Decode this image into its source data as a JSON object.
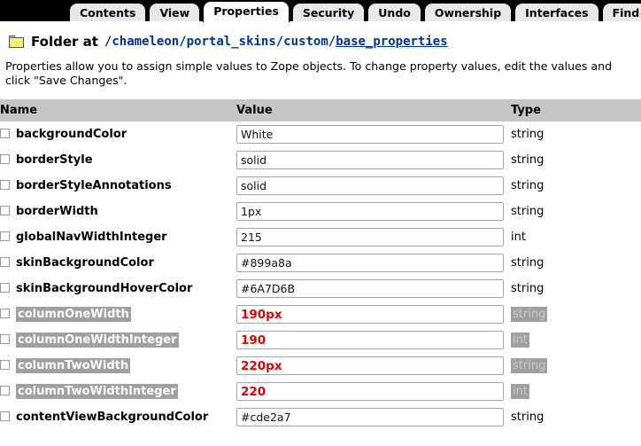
{
  "tabs": [
    {
      "label": "Contents",
      "active": false
    },
    {
      "label": "View",
      "active": false
    },
    {
      "label": "Properties",
      "active": true
    },
    {
      "label": "Security",
      "active": false
    },
    {
      "label": "Undo",
      "active": false
    },
    {
      "label": "Ownership",
      "active": false
    },
    {
      "label": "Interfaces",
      "active": false
    },
    {
      "label": "Find",
      "active": false
    }
  ],
  "header": {
    "icon": "folder-icon",
    "label": "Folder at",
    "path_prefix": "/chameleon/portal_skins/custom/",
    "path_link": "base_properties"
  },
  "description": "Properties allow you to assign simple values to Zope objects. To change property values, edit the values and click \"Save Changes\".",
  "table": {
    "columns": [
      "Name",
      "Value",
      "Type"
    ],
    "rows": [
      {
        "name": "backgroundColor",
        "value": "White",
        "type": "string",
        "highlight": false
      },
      {
        "name": "borderStyle",
        "value": "solid",
        "type": "string",
        "highlight": false
      },
      {
        "name": "borderStyleAnnotations",
        "value": "solid",
        "type": "string",
        "highlight": false
      },
      {
        "name": "borderWidth",
        "value": "1px",
        "type": "string",
        "highlight": false
      },
      {
        "name": "globalNavWidthInteger",
        "value": "215",
        "type": "int",
        "highlight": false
      },
      {
        "name": "skinBackgroundColor",
        "value": "#899a8a",
        "type": "string",
        "highlight": false
      },
      {
        "name": "skinBackgroundHoverColor",
        "value": "#6A7D6B",
        "type": "string",
        "highlight": false
      },
      {
        "name": "columnOneWidth",
        "value": "190px",
        "type": "string",
        "highlight": true
      },
      {
        "name": "columnOneWidthInteger",
        "value": "190",
        "type": "int",
        "highlight": true
      },
      {
        "name": "columnTwoWidth",
        "value": "220px",
        "type": "string",
        "highlight": true
      },
      {
        "name": "columnTwoWidthInteger",
        "value": "220",
        "type": "int",
        "highlight": true
      },
      {
        "name": "contentViewBackgroundColor",
        "value": "#cde2a7",
        "type": "string",
        "highlight": false
      }
    ]
  },
  "colors": {
    "tabbar_background": "#000000",
    "tab_inactive": "#e8e8e8",
    "tab_active": "#ffffff",
    "table_header": "#c6c6c6",
    "path_link": "#00309a",
    "highlight_background": "#a0a0a0",
    "highlight_value_text": "#e60000"
  }
}
